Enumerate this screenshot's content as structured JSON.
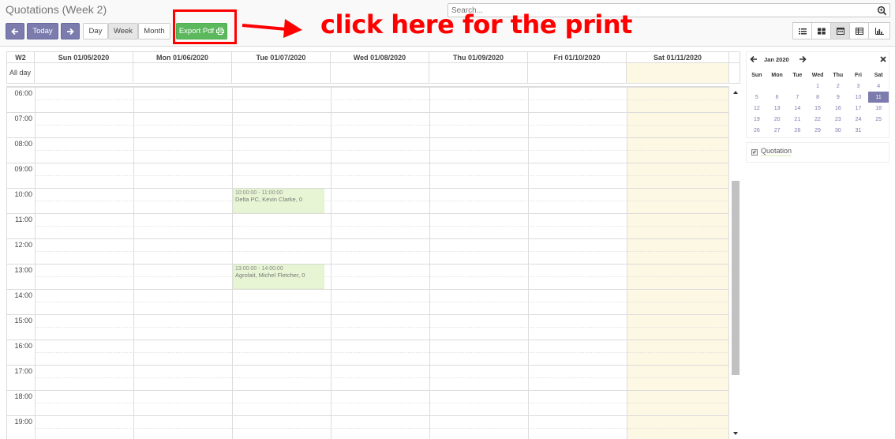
{
  "header": {
    "title": "Quotations (Week 2)",
    "search_placeholder": "Search...",
    "prev_icon": "arrow-left-icon",
    "next_icon": "arrow-right-icon",
    "today_label": "Today",
    "view_day": "Day",
    "view_week": "Week",
    "view_month": "Month",
    "active_view": "Week",
    "export_label": "Export Pdf",
    "annotation": "click here for the print",
    "annotation_color": "#ff0000",
    "view_switcher": [
      "list-icon",
      "kanban-icon",
      "calendar-icon",
      "pivot-icon",
      "graph-icon"
    ],
    "active_switcher": "calendar-icon"
  },
  "calendar": {
    "week_label": "W2",
    "allday_label": "All day",
    "days": [
      "Sun 01/05/2020",
      "Mon 01/06/2020",
      "Tue 01/07/2020",
      "Wed 01/08/2020",
      "Thu 01/09/2020",
      "Fri 01/10/2020",
      "Sat 01/11/2020"
    ],
    "hours": [
      "06:00",
      "07:00",
      "08:00",
      "09:00",
      "10:00",
      "11:00",
      "12:00",
      "13:00",
      "14:00",
      "15:00",
      "16:00",
      "17:00",
      "18:00",
      "19:00"
    ],
    "events": [
      {
        "time": "10:00:00 - 11:00:00",
        "title": "Delta PC, Kevin Clarke, 0"
      },
      {
        "time": "13:00:00 - 14:00:00",
        "title": "Agrolait, Michel Fletcher, 0"
      }
    ],
    "highlight_color": "#fcf8e3",
    "event_color": "#e8f5d4"
  },
  "mini_calendar": {
    "month": "Jan 2020",
    "weekdays": [
      "Sun",
      "Mon",
      "Tue",
      "Wed",
      "Thu",
      "Fri",
      "Sat"
    ],
    "weeks": [
      [
        "",
        "",
        "",
        "1",
        "2",
        "3",
        "4"
      ],
      [
        "5",
        "6",
        "7",
        "8",
        "9",
        "10",
        "11"
      ],
      [
        "12",
        "13",
        "14",
        "15",
        "16",
        "17",
        "18"
      ],
      [
        "19",
        "20",
        "21",
        "22",
        "23",
        "24",
        "25"
      ],
      [
        "26",
        "27",
        "28",
        "29",
        "30",
        "31",
        ""
      ]
    ],
    "selected": "11",
    "accent_color": "#7c7bad"
  },
  "filters": {
    "items": [
      {
        "label": "Quotation",
        "checked": true
      }
    ]
  }
}
